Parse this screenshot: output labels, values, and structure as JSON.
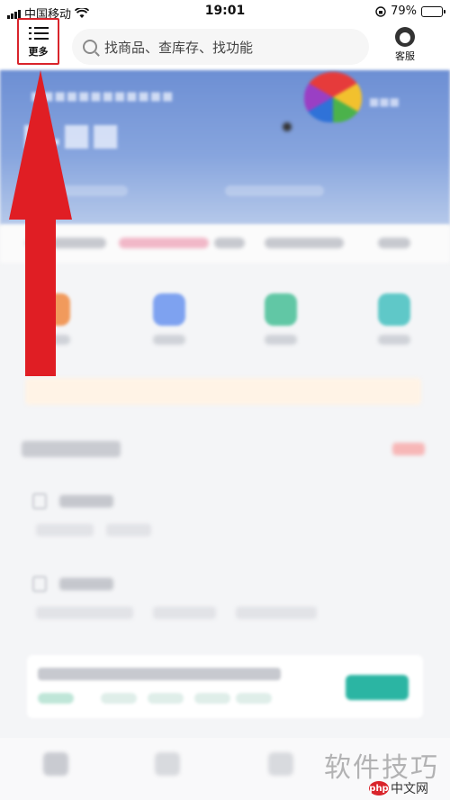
{
  "status_bar": {
    "carrier": "中国移动",
    "time": "19:01",
    "battery": "79%",
    "battery_level": 0.79
  },
  "header": {
    "more_label": "更多",
    "search_placeholder": "找商品、查库存、找功能",
    "customer_service_label": "客服"
  },
  "watermark": {
    "text": "软件技巧",
    "site": "中文网",
    "brand": "php"
  },
  "colors": {
    "annotation_red": "#d9242b",
    "banner_blue": "#7a99d9",
    "teal": "#2bb5a3"
  },
  "icons": {
    "menu": "menu-icon",
    "search": "search-icon",
    "headset": "customer-service-icon",
    "wifi": "wifi-icon",
    "lock": "rotation-lock-icon",
    "battery": "battery-icon"
  }
}
